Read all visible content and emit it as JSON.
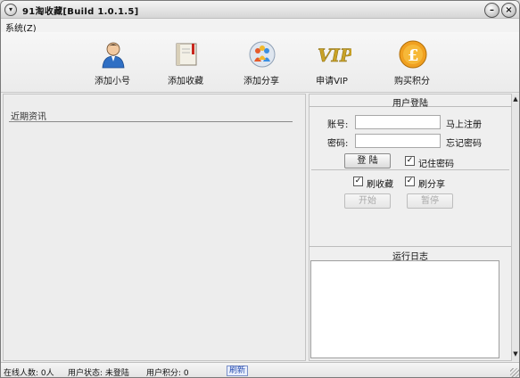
{
  "window": {
    "title": "91淘收藏[Build  1.0.1.5]",
    "minimize_glyph": "–",
    "close_glyph": "×",
    "system_menu_glyph": "▾"
  },
  "menubar": {
    "items": [
      {
        "label": "系统(Z)"
      }
    ]
  },
  "toolbar": {
    "buttons": [
      {
        "label": "添加小号",
        "icon": "user-icon"
      },
      {
        "label": "添加收藏",
        "icon": "book-icon"
      },
      {
        "label": "添加分享",
        "icon": "share-icon"
      },
      {
        "label": "申请VIP",
        "icon": "vip-icon"
      },
      {
        "label": "购买积分",
        "icon": "coin-icon"
      }
    ]
  },
  "news": {
    "title": "近期资讯"
  },
  "login": {
    "header": "用户登陆",
    "account_label": "账号:",
    "account_value": "",
    "password_label": "密码:",
    "password_value": "",
    "register_link": "马上注册",
    "forgot_link": "忘记密码",
    "login_button": "登 陆",
    "remember_label": "记住密码",
    "remember_checked": true
  },
  "tasks": {
    "brush_collect_label": "刷收藏",
    "brush_collect_checked": true,
    "brush_share_label": "刷分享",
    "brush_share_checked": true,
    "start_button": "开始",
    "pause_button": "暂停"
  },
  "log": {
    "header": "运行日志",
    "content": ""
  },
  "statusbar": {
    "online_count": "在线人数: 0人",
    "user_status": "用户状态: 未登陆",
    "user_points": "用户积分: 0",
    "refresh_label": "刷新"
  },
  "colors": {
    "vip_accent": "#c9a227",
    "coin_orange": "#f0a020",
    "user_blue": "#2f6fc4",
    "link_blue": "#2a4fb0"
  }
}
